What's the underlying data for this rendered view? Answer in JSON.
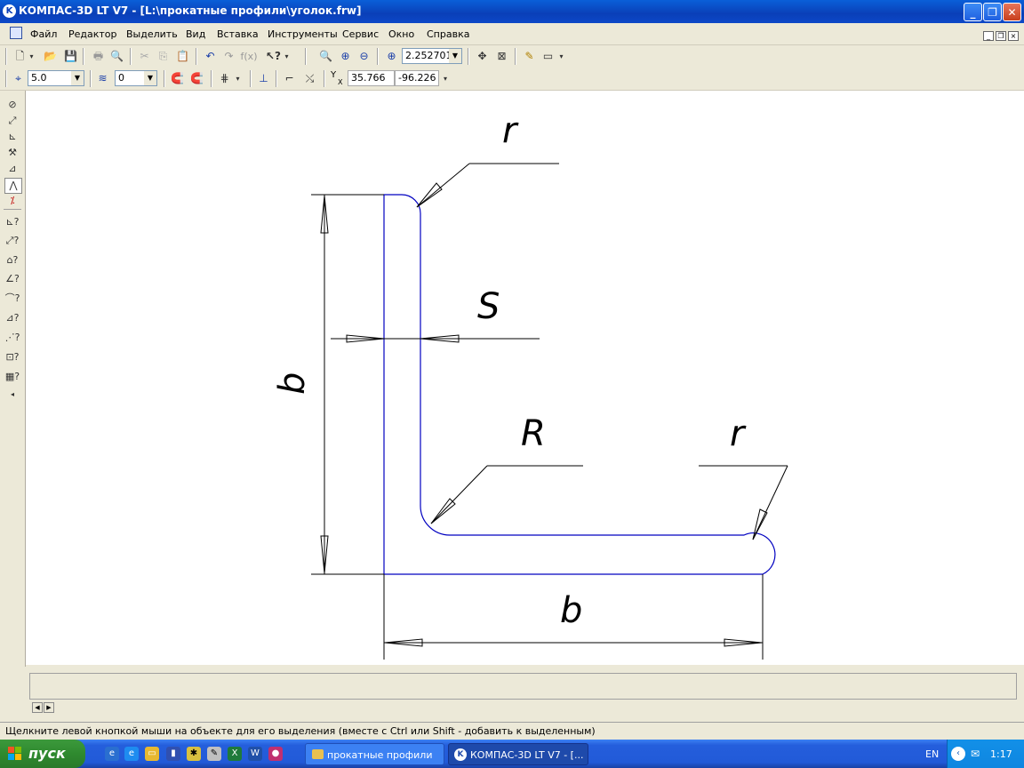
{
  "window": {
    "title": "КОМПАС-3D LT V7 - [L:\\прокатные профили\\уголок.frw]",
    "minimize": "_",
    "restore": "❐",
    "close": "✕"
  },
  "menu": {
    "items": [
      "Файл",
      "Редактор",
      "Выделить",
      "Вид",
      "Вставка",
      "Инструменты",
      "Сервис",
      "Окно",
      "Справка"
    ],
    "mdi_minimize": "_",
    "mdi_restore": "❐",
    "mdi_close": "×"
  },
  "toolbar1": {
    "zoom_value": "2.252701"
  },
  "toolbar2": {
    "step_value": "5.0",
    "layer_value": "0",
    "coord_x": "35.766",
    "coord_y": "-96.226",
    "coord_label": "Y",
    "coord_sub": "X"
  },
  "drawing": {
    "label_r_top": "r",
    "label_s": "S",
    "label_b_vertical": "b",
    "label_R": "R",
    "label_r_right": "r",
    "label_b_horizontal": "b"
  },
  "status": {
    "text": "Щелкните левой кнопкой мыши на объекте для его выделения (вместе с Ctrl или Shift - добавить к выделенным)"
  },
  "taskbar": {
    "start_label": "пуск",
    "tasks": [
      {
        "label": "прокатные профили"
      },
      {
        "label": "КОМПАС-3D LT V7 - [..."
      }
    ],
    "language": "EN",
    "clock": "1:17"
  },
  "colors": {
    "titlebar": "#0a3fb8",
    "taskbar": "#245edc",
    "start": "#2f8a2f",
    "profile_line": "#0000c0",
    "dimension_line": "#000000"
  }
}
